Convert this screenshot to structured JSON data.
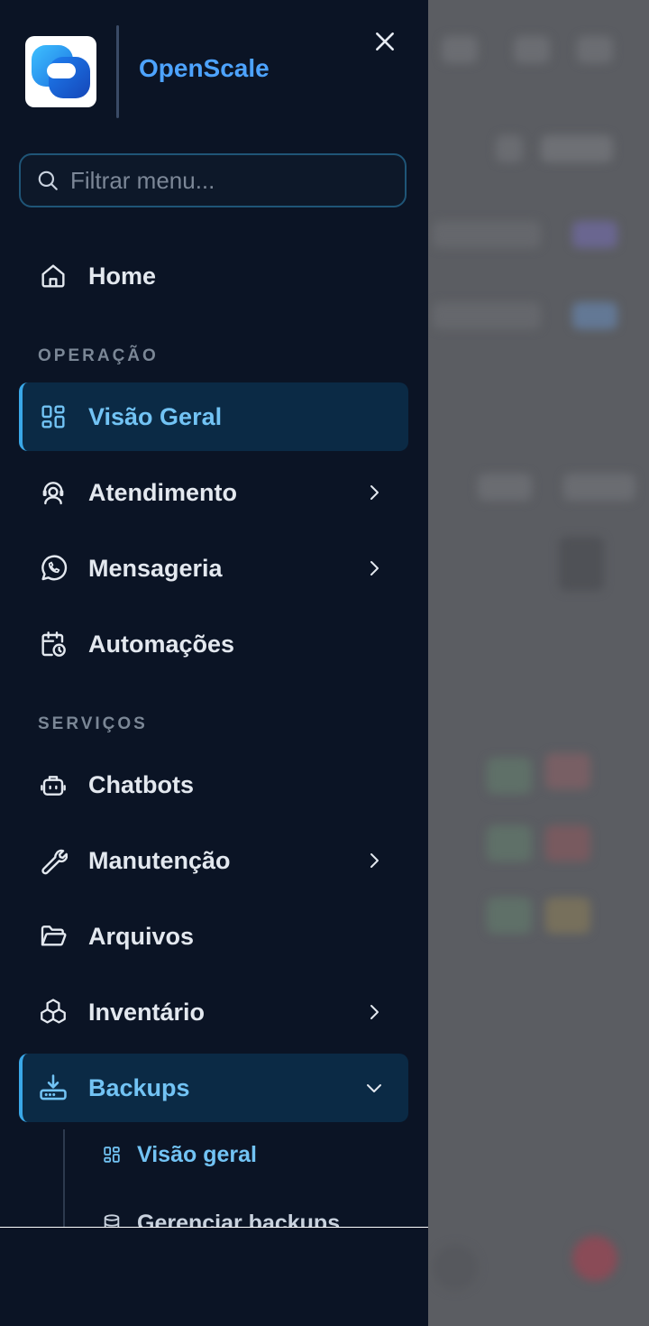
{
  "brand": {
    "name": "OpenScale"
  },
  "search": {
    "placeholder": "Filtrar menu..."
  },
  "nav": {
    "home": "Home",
    "section_operacao": "OPERAÇÃO",
    "visao_geral": "Visão Geral",
    "atendimento": "Atendimento",
    "mensageria": "Mensageria",
    "automacoes": "Automações",
    "section_servicos": "SERVIÇOS",
    "chatbots": "Chatbots",
    "manutencao": "Manutenção",
    "arquivos": "Arquivos",
    "inventario": "Inventário",
    "backups": "Backups",
    "backups_sub": {
      "visao_geral": "Visão geral",
      "gerenciar": "Gerenciar backups"
    }
  },
  "colors": {
    "drawer_bg": "#0b1425",
    "accent": "#3aa8e8",
    "active_bg": "#0b2a45",
    "brand": "#4da3ff"
  }
}
